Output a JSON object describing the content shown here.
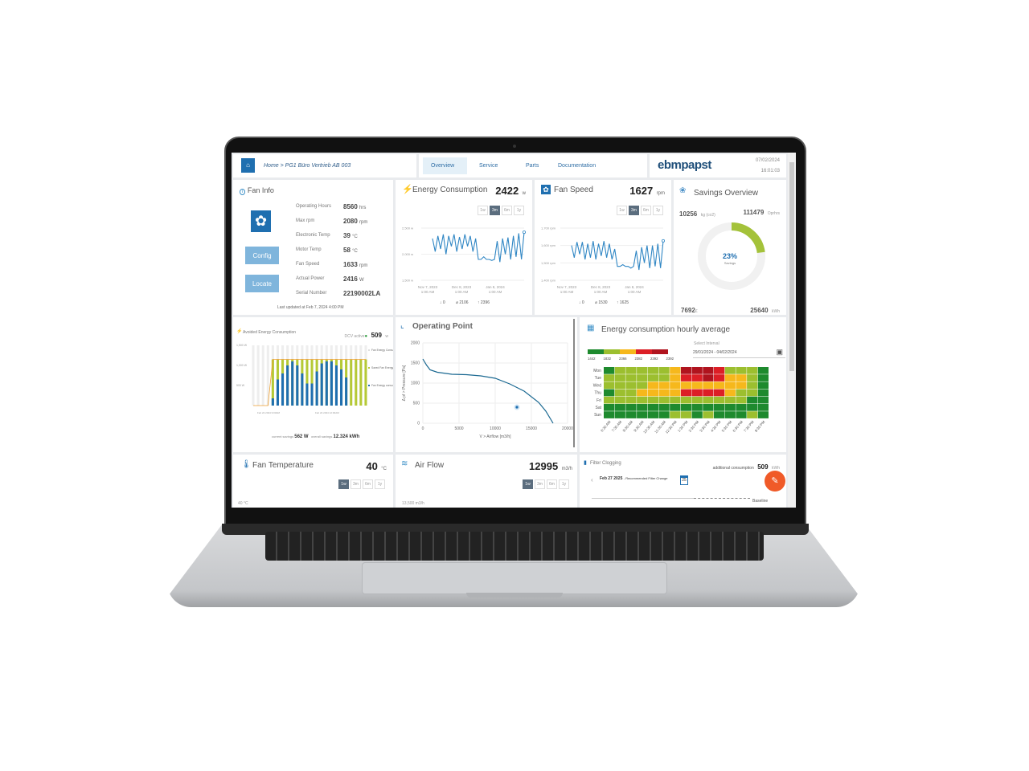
{
  "header": {
    "breadcrumb": "Home > PG1 Büro Vertrieb AB 003",
    "tabs": [
      "Overview",
      "Service",
      "Parts",
      "Documentation"
    ],
    "active_tab": "Overview",
    "brand": "ebmpapst",
    "date": "07/02/2024",
    "time": "16:01:03"
  },
  "fan_info": {
    "title": "Fan Info",
    "config": "Config",
    "locate": "Locate",
    "rows": [
      {
        "label": "Operating Hours",
        "value": "8560",
        "unit": "hrs"
      },
      {
        "label": "Max rpm",
        "value": "2080",
        "unit": "rpm"
      },
      {
        "label": "Electronic Temp",
        "value": "39",
        "unit": "°C"
      },
      {
        "label": "Motor Temp",
        "value": "58",
        "unit": "°C"
      },
      {
        "label": "Fan Speed",
        "value": "1633",
        "unit": "rpm"
      },
      {
        "label": "Actual Power",
        "value": "2416",
        "unit": "W"
      },
      {
        "label": "Serial Number",
        "value": "22190002LA",
        "unit": ""
      }
    ],
    "updated": "Last updated at Feb 7, 2024 4:00 PM"
  },
  "ranges": [
    "1w",
    "3m",
    "6m",
    "1y"
  ],
  "energy": {
    "title": "Energy Consumption",
    "value": "2422",
    "unit": "w",
    "active_range": "3m",
    "yticks": [
      "2,500 w",
      "2,000 w",
      "1,500 w"
    ],
    "xticks": [
      "Nov 7, 2023",
      "Dec 8, 2023",
      "Jan 8, 2024"
    ],
    "xsub": "1:00 AM",
    "min": "↓ 0",
    "avg": "⌀ 2106",
    "max": "↑ 2396"
  },
  "fan_speed": {
    "title": "Fan Speed",
    "value": "1627",
    "unit": "rpm",
    "active_range": "3m",
    "yticks": [
      "1,700 rpm",
      "1,600 rpm",
      "1,500 rpm",
      "1,400 rpm"
    ],
    "xticks": [
      "Nov 7, 2023",
      "Dec 8, 2023",
      "Jan 8, 2024"
    ],
    "xsub": "1:00 AM",
    "min": "↓ 0",
    "avg": "⌀ 1530",
    "max": "↑ 1625"
  },
  "savings": {
    "title": "Savings Overview",
    "co2": "10256",
    "co2_unit": "kg (co2)",
    "hours": "111479",
    "hours_unit": "Oprhrs",
    "percent": "23%",
    "percent_label": "Savings",
    "money": "7692",
    "money_unit": "€",
    "kwh": "25640",
    "kwh_unit": "kWh",
    "fraction": 0.23,
    "color": "#a4c23a"
  },
  "avoided": {
    "title": "Avoided Energy Consumption",
    "dcv": "DCV active",
    "value": "509",
    "unit": "w",
    "yticks": [
      "1,500 W",
      "1,000 W",
      "500 W"
    ],
    "xticks": [
      "Feb 22 2024 9:00AM",
      "Feb 22 2024 12:00AM"
    ],
    "legend": [
      "Fan Energy Consumption without DCV",
      "Saved Fan Energy consumption with DCV",
      "Fan Energy consumption with DCV"
    ],
    "current_label": "current savings",
    "current": "562 W",
    "overall_label": "overall savings",
    "overall": "12.324 kWh"
  },
  "operating": {
    "title": "Operating Point",
    "ylabel": "Δ pf > Pressure [Pa]",
    "xlabel": "V > Airflow [m3/h]",
    "xticks": [
      "0",
      "5000",
      "10000",
      "15000",
      "20000"
    ],
    "yticks": [
      "2000",
      "1500",
      "1000",
      "500",
      "0"
    ]
  },
  "heatmap": {
    "title": "Energy consumption hourly average",
    "legend": [
      "1442",
      "1832",
      "2366",
      "2382",
      "2392",
      "2392"
    ],
    "interval_label": "Select Interval",
    "interval": "29/01/2024 - 04/02/2024",
    "days": [
      "Mon",
      "Tue",
      "Wed",
      "Thu",
      "Fri",
      "Sat",
      "Sun"
    ],
    "hours": [
      "6:30 AM",
      "7:30 AM",
      "8:30 AM",
      "9:30 AM",
      "10:30 AM",
      "11:30 AM",
      "12:30 PM",
      "1:30 PM",
      "2:30 PM",
      "3:30 PM",
      "4:30 PM",
      "5:30 PM",
      "6:30 PM",
      "7:30 PM",
      "8:30 PM"
    ]
  },
  "fan_temp": {
    "title": "Fan Temperature",
    "value": "40",
    "unit": "°C",
    "active_range": "1w",
    "ytick": "40 °C"
  },
  "air_flow": {
    "title": "Air Flow",
    "value": "12995",
    "unit": "m3/h",
    "active_range": "1w",
    "ytick": "13,500 m3/h"
  },
  "filter": {
    "title": "Filter Clogging",
    "add_label": "additional consumption",
    "value": "509",
    "unit": "kWh",
    "date": "Feb 27 2025",
    "note": "- Recommended Filter Change",
    "cal_day": "25",
    "baseline": "Baseline"
  },
  "chart_data": [
    {
      "type": "line",
      "title": "Energy Consumption",
      "ylim": [
        1500,
        2500
      ],
      "values": [
        2300,
        2050,
        2350,
        2100,
        2380,
        2000,
        2350,
        2150,
        2380,
        2050,
        2330,
        2100,
        2380,
        2150,
        2350,
        2050,
        2300,
        1900,
        1900,
        1950,
        1900,
        1900,
        1880,
        1900,
        2250,
        1850,
        2300,
        2000,
        2320,
        1900,
        2350,
        1950,
        2400,
        1900,
        2422
      ]
    },
    {
      "type": "line",
      "title": "Fan Speed",
      "ylim": [
        1400,
        1700
      ],
      "values": [
        1600,
        1530,
        1620,
        1550,
        1620,
        1520,
        1610,
        1530,
        1625,
        1520,
        1610,
        1540,
        1625,
        1530,
        1610,
        1520,
        1580,
        1480,
        1480,
        1490,
        1480,
        1480,
        1470,
        1480,
        1570,
        1460,
        1590,
        1500,
        1600,
        1470,
        1600,
        1480,
        1610,
        1470,
        1627
      ]
    },
    {
      "type": "bar",
      "title": "Avoided Energy Consumption",
      "ylim": [
        0,
        1500
      ],
      "total": [
        0,
        0,
        0,
        0,
        1150,
        1150,
        1150,
        1150,
        1150,
        1150,
        1150,
        1150,
        1150,
        1150,
        1150,
        1150,
        1150,
        1150,
        1150,
        1150,
        1150,
        1150,
        1150,
        1150
      ],
      "with_dcv": [
        0,
        0,
        0,
        0,
        180,
        650,
        800,
        1000,
        1100,
        1000,
        800,
        550,
        550,
        850,
        1050,
        1100,
        1100,
        1000,
        900,
        700,
        0,
        0,
        0,
        0
      ]
    },
    {
      "type": "line",
      "title": "Operating Point",
      "xlim": [
        0,
        20000
      ],
      "ylim": [
        0,
        2000
      ],
      "x": [
        0,
        500,
        1000,
        2000,
        4000,
        6000,
        8000,
        10000,
        12000,
        14000,
        16000,
        17000,
        18000
      ],
      "y": [
        1600,
        1450,
        1330,
        1270,
        1220,
        1210,
        1180,
        1120,
        980,
        800,
        520,
        300,
        0
      ],
      "point": [
        13000,
        400
      ]
    },
    {
      "type": "heatmap",
      "levels": [
        [
          0,
          1,
          1,
          1,
          1,
          1,
          2,
          4,
          4,
          4,
          3,
          1,
          1,
          1,
          0
        ],
        [
          1,
          1,
          1,
          1,
          1,
          1,
          2,
          3,
          3,
          4,
          3,
          2,
          2,
          1,
          0
        ],
        [
          1,
          1,
          1,
          1,
          2,
          2,
          2,
          2,
          2,
          2,
          2,
          2,
          2,
          1,
          0
        ],
        [
          0,
          1,
          1,
          2,
          2,
          2,
          2,
          3,
          3,
          3,
          3,
          2,
          1,
          1,
          0
        ],
        [
          1,
          1,
          1,
          1,
          1,
          1,
          1,
          1,
          1,
          1,
          1,
          1,
          1,
          0,
          0
        ],
        [
          0,
          0,
          0,
          0,
          0,
          0,
          0,
          0,
          0,
          0,
          0,
          0,
          0,
          0,
          0
        ],
        [
          0,
          0,
          0,
          0,
          0,
          0,
          1,
          1,
          0,
          1,
          0,
          0,
          0,
          1,
          0
        ]
      ],
      "colors": [
        "#1e8a2e",
        "#9cbf2f",
        "#f6b81c",
        "#dc1f26",
        "#b0141e"
      ]
    }
  ]
}
